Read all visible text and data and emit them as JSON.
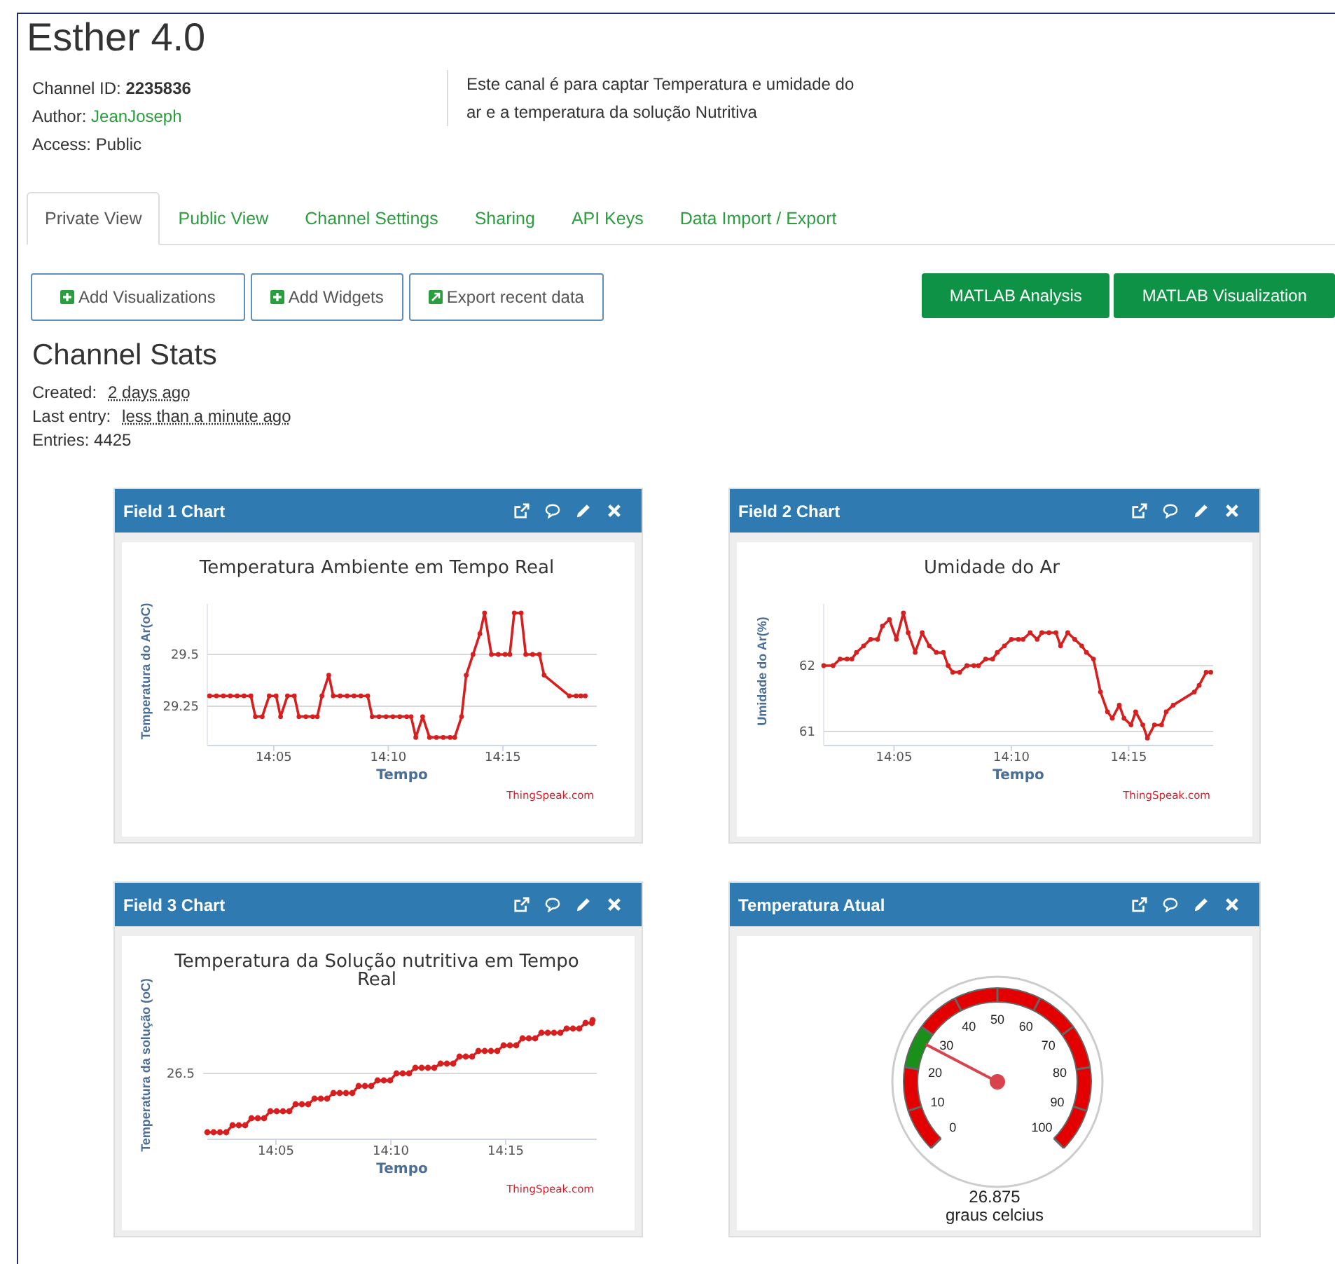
{
  "channel": {
    "title": "Esther 4.0",
    "info": [
      {
        "kind": "text",
        "text": "Channel ID: **2235836**"
      },
      {
        "kind": "link",
        "label": "Author:",
        "link": "JeanJoseph"
      },
      {
        "kind": "text",
        "text": "Access: Public"
      }
    ],
    "description": "Este canal é para captar Temperatura e umidade do ar e a temperatura da solução Nutritiva"
  },
  "tabs": [
    {
      "label": "Private View",
      "selected": true
    },
    {
      "label": "Public View",
      "selected": false
    },
    {
      "label": "Channel Settings",
      "selected": false
    },
    {
      "label": "Sharing",
      "selected": false
    },
    {
      "label": "API Keys",
      "selected": false
    },
    {
      "label": "Data Import / Export",
      "selected": false
    }
  ],
  "actions": [
    {
      "kind": "add",
      "label": "Add Visualizations"
    },
    {
      "kind": "add",
      "label": "Add Widgets"
    },
    {
      "kind": "export",
      "label": "Export recent data"
    }
  ],
  "matlab_buttons": [
    "MATLAB Analysis",
    "MATLAB Visualization"
  ],
  "stats": {
    "title": "Channel Stats",
    "rows": [
      {
        "label": "Created:",
        "value": "2 days ago"
      },
      {
        "label": "Last entry:",
        "value": "less than a minute ago"
      }
    ],
    "entries": "Entries: 4425"
  },
  "widgets": [
    {
      "kind": "chart",
      "title": "Field 1 Chart",
      "credit": "ThingSpeak.com",
      "chart_data": {
        "type": "line",
        "title": "Temperatura Ambiente em Tempo Real",
        "xlabel": "Tempo",
        "ylabel": "Temperatura do Ar(oC)",
        "x": [
          842.2,
          842.5,
          842.8,
          843.1,
          843.4,
          843.7,
          844.0,
          844.2,
          844.5,
          844.8,
          845.1,
          845.3,
          845.6,
          845.9,
          846.1,
          846.4,
          846.7,
          846.9,
          847.1,
          847.4,
          847.6,
          847.9,
          848.2,
          848.5,
          848.8,
          849.1,
          849.3,
          849.6,
          849.9,
          850.2,
          850.5,
          850.8,
          851.0,
          851.2,
          851.5,
          851.8,
          852.1,
          852.4,
          852.7,
          852.9,
          853.2,
          853.4,
          853.7,
          854.0,
          854.2,
          854.5,
          854.8,
          855.1,
          855.3,
          855.5,
          855.8,
          856.0,
          856.3,
          856.6,
          856.8,
          857.9,
          858.2,
          858.4,
          858.6
        ],
        "series": [
          {
            "color": "#d62020",
            "values": [
              29.3,
              29.3,
              29.3,
              29.3,
              29.3,
              29.3,
              29.3,
              29.2,
              29.2,
              29.3,
              29.3,
              29.2,
              29.3,
              29.3,
              29.2,
              29.2,
              29.2,
              29.2,
              29.3,
              29.4,
              29.3,
              29.3,
              29.3,
              29.3,
              29.3,
              29.3,
              29.2,
              29.2,
              29.2,
              29.2,
              29.2,
              29.2,
              29.2,
              29.1,
              29.2,
              29.1,
              29.1,
              29.1,
              29.1,
              29.1,
              29.2,
              29.4,
              29.5,
              29.6,
              29.7,
              29.5,
              29.5,
              29.5,
              29.5,
              29.7,
              29.7,
              29.5,
              29.5,
              29.5,
              29.4,
              29.3,
              29.3,
              29.3,
              29.3
            ]
          }
        ],
        "xlim": [
          842.1,
          859.1
        ],
        "ylim": [
          29.061,
          29.743
        ],
        "xticks": [
          {
            "value": 845,
            "label": "14:05"
          },
          {
            "value": 850,
            "label": "14:10"
          },
          {
            "value": 855,
            "label": "14:15"
          }
        ],
        "yticks": [
          {
            "value": 29.25,
            "label": "29.25"
          },
          {
            "value": 29.5,
            "label": "29.5"
          }
        ]
      }
    },
    {
      "kind": "chart",
      "title": "Field 2 Chart",
      "credit": "ThingSpeak.com",
      "chart_data": {
        "type": "line",
        "title": "Umidade do Ar",
        "xlabel": "Tempo",
        "ylabel": "Umidade do Ar(%)",
        "x": [
          842.0,
          842.4,
          842.7,
          843.0,
          843.2,
          843.4,
          843.7,
          844.0,
          844.3,
          844.5,
          844.8,
          845.1,
          845.4,
          845.6,
          845.9,
          846.2,
          846.5,
          846.8,
          847.1,
          847.3,
          847.5,
          847.8,
          848.1,
          848.4,
          848.6,
          848.9,
          849.2,
          849.4,
          849.7,
          850.0,
          850.3,
          850.5,
          850.8,
          851.1,
          851.3,
          851.6,
          851.9,
          852.1,
          852.4,
          852.7,
          853.0,
          853.2,
          853.5,
          853.8,
          854.1,
          854.3,
          854.6,
          854.8,
          855.1,
          855.3,
          855.6,
          855.8,
          856.1,
          856.4,
          856.6,
          856.9,
          857.8,
          858.0,
          858.3,
          858.5
        ],
        "series": [
          {
            "color": "#d62020",
            "values": [
              62.0,
              62.0,
              62.1,
              62.1,
              62.1,
              62.2,
              62.3,
              62.4,
              62.4,
              62.6,
              62.7,
              62.4,
              62.8,
              62.5,
              62.2,
              62.5,
              62.3,
              62.2,
              62.2,
              62.0,
              61.9,
              61.9,
              62.0,
              62.0,
              62.0,
              62.1,
              62.1,
              62.2,
              62.3,
              62.4,
              62.4,
              62.4,
              62.5,
              62.4,
              62.5,
              62.5,
              62.5,
              62.3,
              62.5,
              62.4,
              62.3,
              62.2,
              62.1,
              61.6,
              61.3,
              61.2,
              61.4,
              61.2,
              61.1,
              61.3,
              61.1,
              60.9,
              61.1,
              61.1,
              61.3,
              61.4,
              61.6,
              61.7,
              61.9,
              61.9
            ]
          }
        ],
        "xlim": [
          842.0,
          858.6
        ],
        "ylim": [
          60.787,
          62.936
        ],
        "xticks": [
          {
            "value": 845,
            "label": "14:05"
          },
          {
            "value": 850,
            "label": "14:10"
          },
          {
            "value": 855,
            "label": "14:15"
          }
        ],
        "yticks": [
          {
            "value": 61,
            "label": "61"
          },
          {
            "value": 62,
            "label": "62"
          }
        ]
      }
    },
    {
      "kind": "line_picture",
      "title": "Field 3 Chart",
      "credit": "ThingSpeak.com",
      "chart_title": "Temperatura da Solução nutritiva em Tempo Real",
      "xlabel": "Tempo",
      "ylabel": "Temperatura da solução (oC)",
      "y_tick_labels": [
        "26.5"
      ],
      "x_tick_labels": [
        "14:05",
        "14:10",
        "14:15"
      ]
    },
    {
      "kind": "gauge",
      "title": "Temperatura Atual",
      "labels": [
        "0",
        "10",
        "20",
        "30",
        "40",
        "50",
        "60",
        "70",
        "80",
        "90",
        "100"
      ],
      "value": "26.875",
      "units": "graus celcius"
    }
  ]
}
